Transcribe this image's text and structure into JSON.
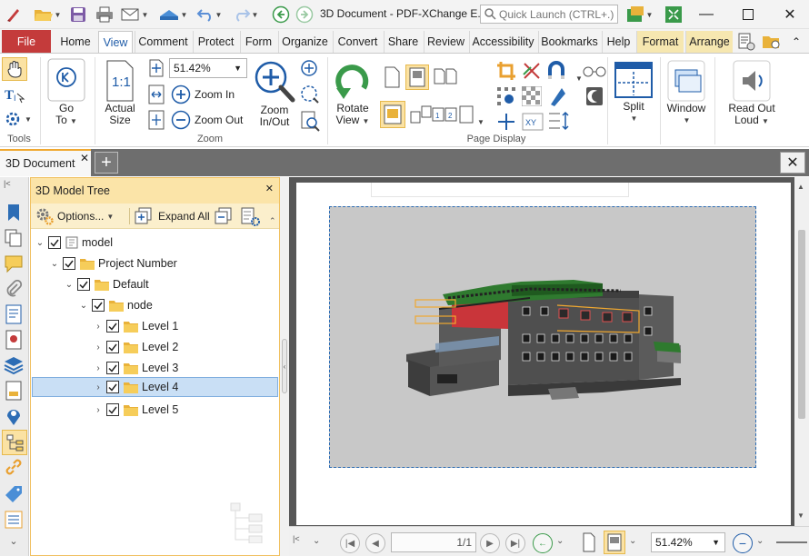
{
  "window": {
    "title": "3D Document - PDF-XChange E...",
    "quick_launch_placeholder": "Quick Launch (CTRL+.)"
  },
  "menu_tabs": [
    {
      "label": "File"
    },
    {
      "label": "Home"
    },
    {
      "label": "View"
    },
    {
      "label": "Comment"
    },
    {
      "label": "Protect"
    },
    {
      "label": "Form"
    },
    {
      "label": "Organize"
    },
    {
      "label": "Convert"
    },
    {
      "label": "Share"
    },
    {
      "label": "Review"
    },
    {
      "label": "Accessibility"
    },
    {
      "label": "Bookmarks"
    },
    {
      "label": "Help"
    },
    {
      "label": "Format"
    },
    {
      "label": "Arrange"
    }
  ],
  "ribbon": {
    "tools_label": "Tools",
    "goto": {
      "line1": "Go",
      "line2": "To"
    },
    "actual_size": {
      "line1": "Actual",
      "line2": "Size"
    },
    "zoom_value": "51.42%",
    "zoom_in": "Zoom In",
    "zoom_out": "Zoom Out",
    "zoom_in_out": {
      "line1": "Zoom",
      "line2": "In/Out"
    },
    "zoom_label": "Zoom",
    "rotate_view": {
      "line1": "Rotate",
      "line2": "View"
    },
    "page_display_label": "Page Display",
    "split": "Split",
    "window": "Window",
    "read_out_loud": {
      "line1": "Read Out",
      "line2": "Loud"
    }
  },
  "doc_tab": {
    "label": "3D Document"
  },
  "panel": {
    "title": "3D Model Tree",
    "options_label": "Options...",
    "expand_all_label": "Expand All",
    "tree": [
      {
        "label": "model",
        "indent": 0,
        "expanded": true,
        "checked": true,
        "icon": "model-icon",
        "selected": false
      },
      {
        "label": "Project Number",
        "indent": 1,
        "expanded": true,
        "checked": true,
        "icon": "folder-icon",
        "selected": false
      },
      {
        "label": "Default",
        "indent": 2,
        "expanded": true,
        "checked": true,
        "icon": "folder-icon",
        "selected": false
      },
      {
        "label": "node",
        "indent": 3,
        "expanded": true,
        "checked": true,
        "icon": "folder-icon",
        "selected": false
      },
      {
        "label": "Level 1",
        "indent": 4,
        "expanded": false,
        "checked": true,
        "icon": "folder-icon",
        "selected": false
      },
      {
        "label": "Level 2",
        "indent": 4,
        "expanded": false,
        "checked": true,
        "icon": "folder-icon",
        "selected": false
      },
      {
        "label": "Level 3",
        "indent": 4,
        "expanded": false,
        "checked": true,
        "icon": "folder-icon",
        "selected": false
      },
      {
        "label": "Level 4",
        "indent": 4,
        "expanded": false,
        "checked": true,
        "icon": "folder-icon",
        "selected": true
      },
      {
        "label": "Level 5",
        "indent": 4,
        "expanded": false,
        "checked": true,
        "icon": "folder-icon",
        "selected": false
      }
    ]
  },
  "statusbar": {
    "page_indicator": "1/1",
    "zoom_value": "51.42%"
  },
  "colors": {
    "accent_blue": "#1f5ca8",
    "file_tab": "#c43b3b",
    "panel_header": "#fbe4a8",
    "selection": "#c9dff5"
  }
}
